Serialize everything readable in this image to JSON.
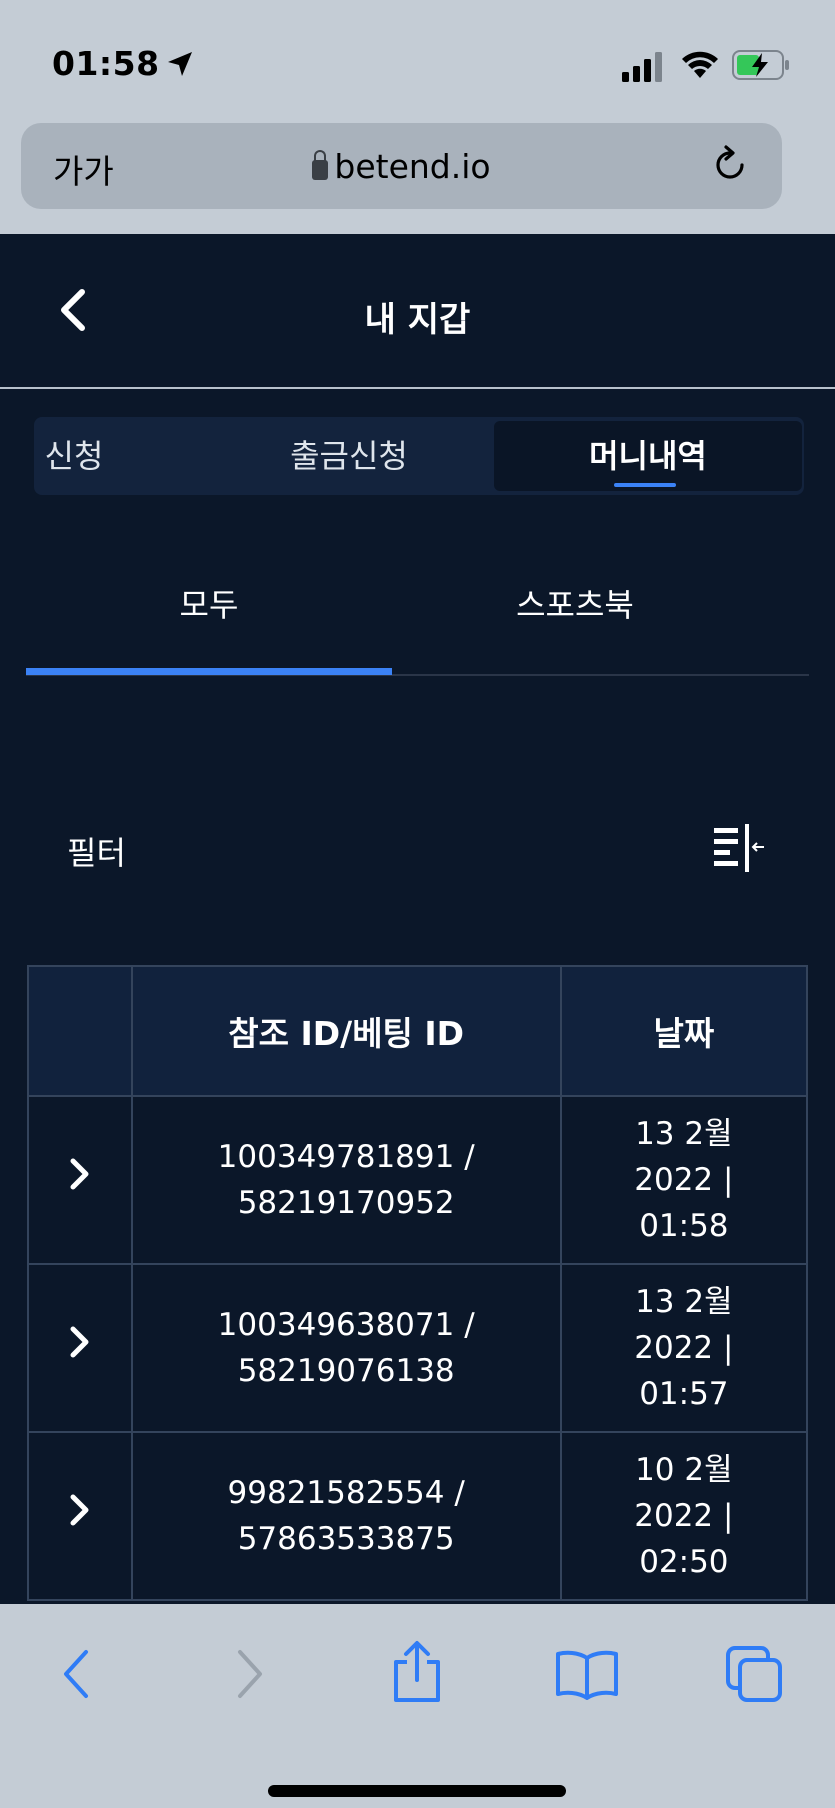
{
  "status": {
    "time": "01:58"
  },
  "browser": {
    "text_size": "가가",
    "url": "betend.io"
  },
  "header": {
    "title": "내 지갑"
  },
  "segments": [
    "신청",
    "출금신청",
    "머니내역"
  ],
  "tabs": [
    "모두",
    "스포츠북"
  ],
  "filter": {
    "label": "필터"
  },
  "table": {
    "headers": [
      "",
      "참조 ID/베팅 ID",
      "날짜"
    ],
    "rows": [
      {
        "ref_line1": "100349781891 /",
        "ref_line2": "58219170952",
        "date_line1": "13 2월",
        "date_line2": "2022 |",
        "date_line3": "01:58"
      },
      {
        "ref_line1": "100349638071 /",
        "ref_line2": "58219076138",
        "date_line1": "13 2월",
        "date_line2": "2022 |",
        "date_line3": "01:57"
      },
      {
        "ref_line1": "99821582554 /",
        "ref_line2": "57863533875",
        "date_line1": "10 2월",
        "date_line2": "2022 |",
        "date_line3": "02:50"
      }
    ]
  },
  "colors": {
    "background": "#0b1729",
    "accent": "#3b82f6",
    "browser_chrome": "#c4ccd5",
    "toolbar_icon": "#2f7cf6"
  }
}
